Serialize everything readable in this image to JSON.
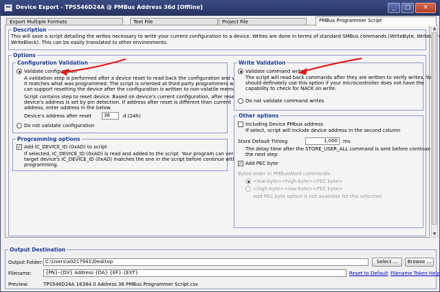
{
  "window": {
    "title": "Device Export - TPS546D24A @ PMBus Address 36d [Offline]",
    "minimize": "_",
    "maximize": "□",
    "close": "×"
  },
  "tabs": [
    "Export Multiple Formats",
    "Text File",
    "Project File",
    "PMBus Programmer Script"
  ],
  "description": {
    "header": "Description",
    "lines": [
      "This will save a script detailing the writes necessary to write your current configuration to a device. Writes are done in terms of standard SMBus commands (WriteByte, WriteWord, and",
      "WriteBlock). This can be easily translated to other environments."
    ]
  },
  "options": {
    "header": "Options",
    "config_validation": {
      "header": "Configuration Validation",
      "validate_label": "Validate configuration",
      "para1": [
        "A validation step is performed after a device reset to read back the configuration and verify",
        "it matches what was programmed. The script is oriented at third party programmers who",
        "can support resetting the device after the configuration is written to non-volatile memory."
      ],
      "para2": [
        "Script contains step to reset device. Based on device's current configuration, after reset,",
        "device's address is set by pin detection. If address after reset is different than current",
        "address, enter address in the below."
      ],
      "address_label": "Device's address after reset",
      "address_value": "36",
      "address_unit": "d (24h)",
      "no_validate_label": "Do not validate configuration"
    },
    "programming_options": {
      "header": "Programming options",
      "add_id_label": "Add IC_DEVICE_ID (0xAD) to script",
      "lines": [
        "If selected, IC_DEVICE_ID (0xAD) is read and added to the script. Your program can verify if",
        "target device's IC_DEVICE_ID (0xAD) matches the one in the script before continue with",
        "programming."
      ]
    },
    "write_validation": {
      "header": "Write Validation",
      "validate_label": "Validate command writes",
      "lines": [
        "The script will read back commands after they are written to verify writes. You",
        "should definately use this option if your microcontroller does not have the",
        "capability to check for NACK on write."
      ],
      "no_validate_label": "Do not validate command writes"
    },
    "other_options": {
      "header": "Other options",
      "include_address_label": "Including Device PMbus address",
      "include_address_note": "If select, script will include device address in the second column",
      "store_timing_label": "Store Default Timing",
      "store_timing_value": "1,000",
      "store_timing_unit": "ms",
      "store_timing_note": [
        "The delay time after the STORE_USER_ALL command is  sent before continue to",
        "the next step"
      ],
      "add_pec_label": "Add PEC byte",
      "bytes_order_label": "Bytes order in PMBusWord commands:",
      "order_option1": "<low-byte><high-byte><PEC byte>",
      "order_option2": "<high-byte><low-byte><PEC byte>",
      "pec_note": "Add PEC byte option is not available for this selection"
    }
  },
  "output": {
    "header": "Output Destination",
    "folder_label": "Output Folder:",
    "folder_value": "C:\\Users\\a0217941\\Desktop",
    "select_button": "Select ...",
    "browse_button": "Browse ...",
    "filename_label": "Filename:",
    "filename_value": "{PN}-{DV} Address {DA} {EF}.{EXT}",
    "reset_link": "Reset to Default",
    "token_link": "Filename Token Help",
    "preview_label": "Preview:",
    "preview_value": "TPS546D24A 16384.0 Address 36 PMBus Programmer Script.csv"
  },
  "colors": {
    "annotation_arrow": "#e01818",
    "group_label": "#1c3c94",
    "link": "#0000cc"
  }
}
